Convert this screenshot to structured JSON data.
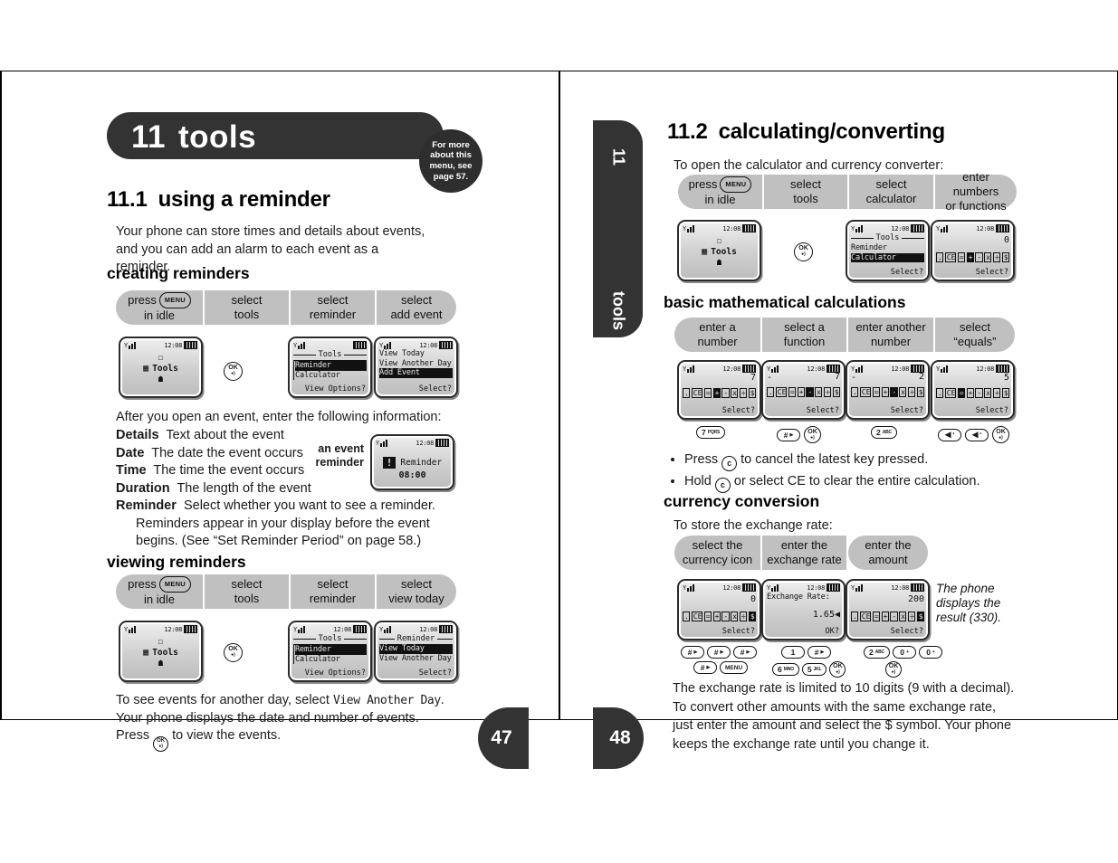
{
  "left_page": {
    "chapter": {
      "number": "11",
      "title": "tools"
    },
    "bubble": "For more about this menu, see page 57.",
    "section": {
      "number": "11.1",
      "title": "using a reminder"
    },
    "intro": "Your phone can store times and details about events, and you can add an alarm to each event as a reminder.",
    "sub1": "creating reminders",
    "steps1": [
      {
        "line1": "press",
        "key": "MENU",
        "line2": "in idle"
      },
      {
        "line1": "select",
        "line2": "tools"
      },
      {
        "line1": "select",
        "line2": "reminder"
      },
      {
        "line1": "select",
        "line2": "add event"
      }
    ],
    "screens1": {
      "idle": {
        "label": "Tools",
        "clock": "12:08"
      },
      "tools": {
        "title": "Tools",
        "items": [
          "Reminder",
          "Calculator"
        ],
        "selected": 0,
        "softkey": "View Options?"
      },
      "reminder": {
        "items": [
          "View Today",
          "View Another Day",
          "Add Event"
        ],
        "selected": 2,
        "softkey": "Select?"
      }
    },
    "after_text": "After you open an event, enter the following information:",
    "definitions": [
      {
        "term": "Details",
        "desc": "Text about the event"
      },
      {
        "term": "Date",
        "desc": "The date the event occurs"
      },
      {
        "term": "Time",
        "desc": "The time the event occurs"
      },
      {
        "term": "Duration",
        "desc": "The length of the event"
      },
      {
        "term": "Reminder",
        "desc": "Select whether you want to see a reminder."
      }
    ],
    "definition_wrap": "Reminders appear in your display before the event begins. (See “Set Reminder Period” on page 58.)",
    "event_caption": "an event reminder",
    "event_screen": {
      "label": "Reminder",
      "time": "08:00",
      "clock": "12:08"
    },
    "sub2": "viewing reminders",
    "steps2": [
      {
        "line1": "press",
        "key": "MENU",
        "line2": "in idle"
      },
      {
        "line1": "select",
        "line2": "tools"
      },
      {
        "line1": "select",
        "line2": "reminder"
      },
      {
        "line1": "select",
        "line2": "view today"
      }
    ],
    "screens2": {
      "idle": {
        "label": "Tools",
        "clock": "12:08"
      },
      "tools": {
        "title": "Tools",
        "items": [
          "Reminder",
          "Calculator"
        ],
        "selected": 0,
        "softkey": "View Options?"
      },
      "reminder": {
        "title": "Reminder",
        "items": [
          "View Today",
          "View Another Day"
        ],
        "selected": 0,
        "softkey": "Select?"
      }
    },
    "closing_1a": "To see events for another day, select ",
    "closing_1b": "View Another Day",
    "closing_1c": ".",
    "closing_2": "Your phone displays the date and number of events.",
    "closing_3a": "Press ",
    "closing_3b": " to view the events.",
    "page_number": "47"
  },
  "right_page": {
    "tab": {
      "number": "11",
      "label": "tools"
    },
    "section": {
      "number": "11.2",
      "title": "calculating/converting"
    },
    "intro": "To open the calculator and currency converter:",
    "steps1": [
      {
        "line1": "press",
        "key": "MENU",
        "line2": "in idle"
      },
      {
        "line1": "select",
        "line2": "tools"
      },
      {
        "line1": "select",
        "line2": "calculator"
      },
      {
        "line1": "enter numbers",
        "line2": "or functions"
      }
    ],
    "screens1": {
      "idle": {
        "label": "Tools",
        "clock": "12:08"
      },
      "tools": {
        "title": "Tools",
        "items": [
          "Reminder",
          "Calculator"
        ],
        "selected": 1,
        "softkey": "Select?"
      },
      "calc": {
        "value": "0",
        "functions": [
          ".",
          "CE",
          "=",
          "+",
          "-",
          "x",
          "÷",
          "$"
        ],
        "active": 3,
        "softkey": "Select?"
      }
    },
    "sub1": "basic mathematical calculations",
    "steps2": [
      {
        "line1": "enter a",
        "line2": "number"
      },
      {
        "line1": "select a",
        "line2": "function"
      },
      {
        "line1": "enter another",
        "line2": "number"
      },
      {
        "line1": "select",
        "line2": "“equals”"
      }
    ],
    "calc_screens": [
      {
        "top": "",
        "value": "7",
        "functions": [
          ".",
          "CE",
          "=",
          "+",
          "-",
          "x",
          "÷",
          "$"
        ],
        "active": 3,
        "softkey": "Select?",
        "keys": [
          {
            "main": "7",
            "sub": "PQRS"
          }
        ]
      },
      {
        "top": "-",
        "value": "7",
        "functions": [
          ".",
          "CE",
          "=",
          "+",
          "-",
          "x",
          "÷",
          "$"
        ],
        "active": 4,
        "softkey": "Select?",
        "keys": [
          {
            "main": "#",
            "sub": "▶"
          },
          {
            "main": "OK"
          }
        ]
      },
      {
        "top": "-",
        "value": "2",
        "functions": [
          ".",
          "CE",
          "=",
          "+",
          "-",
          "x",
          "÷",
          "$"
        ],
        "active": 4,
        "softkey": "Select?",
        "keys": [
          {
            "main": "2",
            "sub": "ABC"
          }
        ]
      },
      {
        "top": "",
        "value": "5",
        "functions": [
          ".",
          "CE",
          "=",
          "+",
          "-",
          "x",
          "÷",
          "$"
        ],
        "active": 2,
        "softkey": "Select?",
        "keys": [
          {
            "main": "◀",
            "sub": "*"
          },
          {
            "main": "◀",
            "sub": "*"
          },
          {
            "main": "OK"
          }
        ]
      }
    ],
    "bullets": [
      {
        "a": "Press ",
        "key": "c",
        "b": " to cancel the latest key pressed."
      },
      {
        "a": "Hold ",
        "key": "c",
        "b": " or select CE to clear the entire calculation."
      }
    ],
    "sub2": "currency conversion",
    "intro2": "To store the exchange rate:",
    "steps3": [
      {
        "line1": "select the",
        "line2": "currency icon"
      },
      {
        "line1": "enter the",
        "line2": "exchange rate"
      },
      {
        "line1": "enter the",
        "line2": "amount"
      }
    ],
    "currency_screens": [
      {
        "kind": "calc",
        "value": "0",
        "functions": [
          ".",
          "CE",
          "=",
          "+",
          "-",
          "x",
          "÷",
          "$"
        ],
        "active": 7,
        "softkey": "Select?"
      },
      {
        "kind": "rate",
        "label": "Exchange Rate:",
        "value": "1.65◀",
        "softkey": "OK?"
      },
      {
        "kind": "calc",
        "value": "200",
        "functions": [
          ".",
          "CE",
          "=",
          "+",
          "-",
          "x",
          "÷",
          "$"
        ],
        "active": 7,
        "softkey": "Select?"
      }
    ],
    "currency_keys": [
      {
        "row1": [
          {
            "main": "#",
            "sub": "▶"
          },
          {
            "main": "#",
            "sub": "▶"
          },
          {
            "main": "#",
            "sub": "▶"
          }
        ],
        "row2": [
          {
            "main": "#",
            "sub": "▶"
          },
          {
            "main": "MENU"
          }
        ]
      },
      {
        "row1": [
          {
            "main": "1"
          },
          {
            "main": "#",
            "sub": "▶"
          }
        ],
        "row2": [
          {
            "main": "6",
            "sub": "MNO"
          },
          {
            "main": "5",
            "sub": "JKL"
          },
          {
            "main": "OK"
          }
        ]
      },
      {
        "row1": [
          {
            "main": "2",
            "sub": "ABC"
          },
          {
            "main": "0",
            "sub": "+"
          },
          {
            "main": "0",
            "sub": "+"
          }
        ],
        "row2": [
          {
            "main": "OK"
          }
        ]
      }
    ],
    "result_note": "The phone displays the result (330).",
    "closing": "The exchange rate is limited to 10 digits (9 with a decimal). To convert other amounts with the same exchange rate, just enter the amount and select the $ symbol. Your phone keeps the exchange rate until you change it.",
    "page_number": "48"
  },
  "colors": {
    "dark": "#333333",
    "pill": "#c0c0c0",
    "lcd": "#d8d8d8"
  }
}
